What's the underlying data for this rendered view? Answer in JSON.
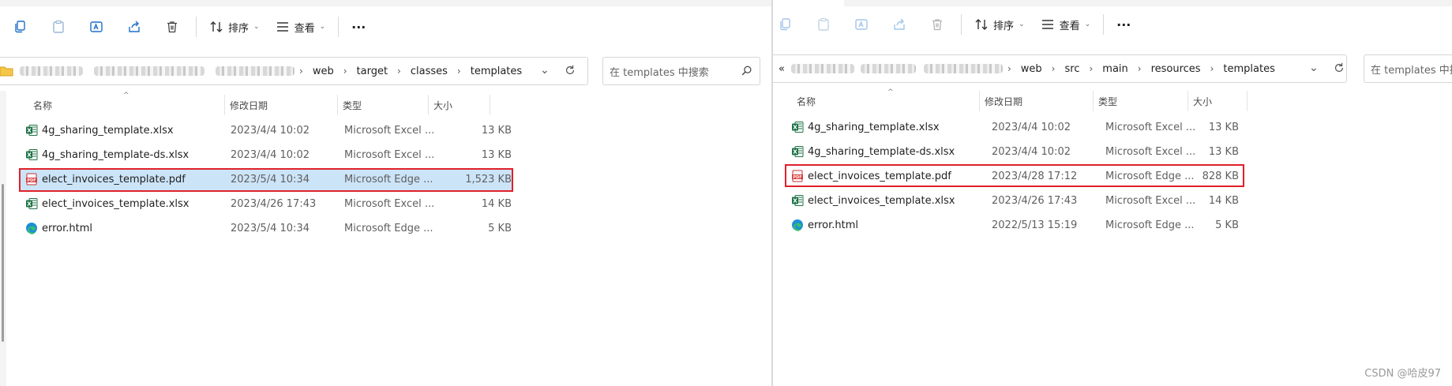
{
  "colors": {
    "selection": "#cce4f7",
    "highlight_box": "#e0202a",
    "excel_green": "#1d7245",
    "pdf_red": "#d83b3b",
    "edge_blue": "#1d8fd6"
  },
  "left": {
    "toolbar": {
      "sort_label": "排序",
      "view_label": "查看",
      "more_label": "···"
    },
    "breadcrumb": [
      "web",
      "target",
      "classes",
      "templates"
    ],
    "search_placeholder": "在 templates 中搜索",
    "columns": {
      "name": "名称",
      "date": "修改日期",
      "type": "类型",
      "size": "大小"
    },
    "files": [
      {
        "name": "4g_sharing_template.xlsx",
        "date": "2023/4/4 10:02",
        "type": "Microsoft Excel ...",
        "size": "13 KB",
        "icon": "excel-icon"
      },
      {
        "name": "4g_sharing_template-ds.xlsx",
        "date": "2023/4/4 10:02",
        "type": "Microsoft Excel ...",
        "size": "13 KB",
        "icon": "excel-icon"
      },
      {
        "name": "elect_invoices_template.pdf",
        "date": "2023/5/4 10:34",
        "type": "Microsoft Edge ...",
        "size": "1,523 KB",
        "icon": "pdf-icon",
        "selected": true
      },
      {
        "name": "elect_invoices_template.xlsx",
        "date": "2023/4/26 17:43",
        "type": "Microsoft Excel ...",
        "size": "14 KB",
        "icon": "excel-icon"
      },
      {
        "name": "error.html",
        "date": "2023/5/4 10:34",
        "type": "Microsoft Edge ...",
        "size": "5 KB",
        "icon": "edge-icon"
      }
    ]
  },
  "right": {
    "toolbar": {
      "sort_label": "排序",
      "view_label": "查看",
      "more_label": "···"
    },
    "breadcrumb_prefix": "«",
    "breadcrumb": [
      "web",
      "src",
      "main",
      "resources",
      "templates"
    ],
    "search_placeholder": "在 templates 中搜",
    "columns": {
      "name": "名称",
      "date": "修改日期",
      "type": "类型",
      "size": "大小"
    },
    "files": [
      {
        "name": "4g_sharing_template.xlsx",
        "date": "2023/4/4 10:02",
        "type": "Microsoft Excel ...",
        "size": "13 KB",
        "icon": "excel-icon"
      },
      {
        "name": "4g_sharing_template-ds.xlsx",
        "date": "2023/4/4 10:02",
        "type": "Microsoft Excel ...",
        "size": "13 KB",
        "icon": "excel-icon"
      },
      {
        "name": "elect_invoices_template.pdf",
        "date": "2023/4/28 17:12",
        "type": "Microsoft Edge ...",
        "size": "828 KB",
        "icon": "pdf-icon"
      },
      {
        "name": "elect_invoices_template.xlsx",
        "date": "2023/4/26 17:43",
        "type": "Microsoft Excel ...",
        "size": "14 KB",
        "icon": "excel-icon"
      },
      {
        "name": "error.html",
        "date": "2022/5/13 15:19",
        "type": "Microsoft Edge ...",
        "size": "5 KB",
        "icon": "edge-icon"
      }
    ]
  },
  "watermark": "CSDN @哈皮97"
}
